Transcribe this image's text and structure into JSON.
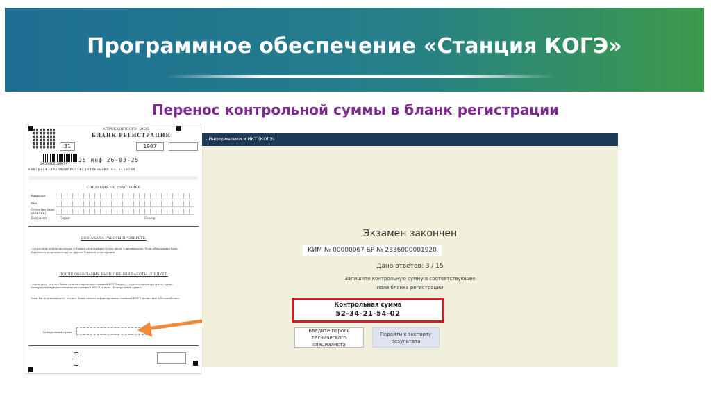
{
  "slide": {
    "title": "Программное обеспечение «Станция КОГЭ»",
    "subtitle": "Перенос контрольной суммы в бланк регистрации",
    "colors": {
      "banner_start": "#1e6e92",
      "banner_end": "#3c9a4a",
      "subtitle": "#7b2a8f",
      "highlight": "#d41f26",
      "arrow": "#f08a3c"
    }
  },
  "form": {
    "approval": "АПРОБАЦИЯ ОГЭ - 2025",
    "title": "БЛАНК РЕГИСТРАЦИИ",
    "region_code": "31",
    "school_code": "1907",
    "barcode_number": "2435018130674",
    "exam_code": "25 инф 26-03-25",
    "alphabet": "АБВГДЕЁЖЗИЙКЛМНОПРСТУФХЦЧШЩЪЫЬЭЮЯ 0123456789",
    "section_participant": "СВЕДЕНИЯ ОБ УЧАСТНИКЕ",
    "labels": {
      "surname": "Фамилия",
      "name": "Имя",
      "patronymic": "Отчество (при наличии)",
      "document": "Документ",
      "series": "Серия",
      "number": "Номер"
    },
    "before_heading": "ДО НАЧАЛА РАБОТЫ ПРОВЕРЬТЕ:",
    "before_text": "– отсутствие дефектов печати в бланке регистрации (в том числе в штрихкодах). Если обнаружили брак, обратитесь к организатору за другим бланком регистрации",
    "after_heading": "ПОСЛЕ ОКОНЧАНИЯ ВЫПОЛНЕНИЯ РАБОТЫ СЛЕДУЕТ:",
    "after_text": "– проверить, что все Ваши ответы сохранены станцией КОГЭ верно; – перенести контрольную сумму, сгенерированную автоматически станцией КОГЭ, в поле «Контрольная сумма».",
    "confirm_text": "Этим Вы подтверждаете, что все Ваши ответы зафиксированы станцией КОГЭ полностью и безошибочно.",
    "checksum_label": "Контрольная сумма"
  },
  "screen": {
    "header": "- Информатики и ИКТ (КОГЭ)",
    "exam_finished": "Экзамен закончен",
    "kim": "КИМ № 00000067 БР № 2336000001920",
    "answers": "Дано ответов: 3 / 15",
    "instruction_1": "Запишите контрольную сумму в соответствующее",
    "instruction_2": "поле бланка регистрации",
    "checksum_label": "Контрольная сумма",
    "checksum_value": "52-34-21-54-02",
    "btn_password_1": "Введите пароль",
    "btn_password_2": "технического специалиста",
    "btn_export_1": "Перейти к экспорту",
    "btn_export_2": "результата"
  }
}
